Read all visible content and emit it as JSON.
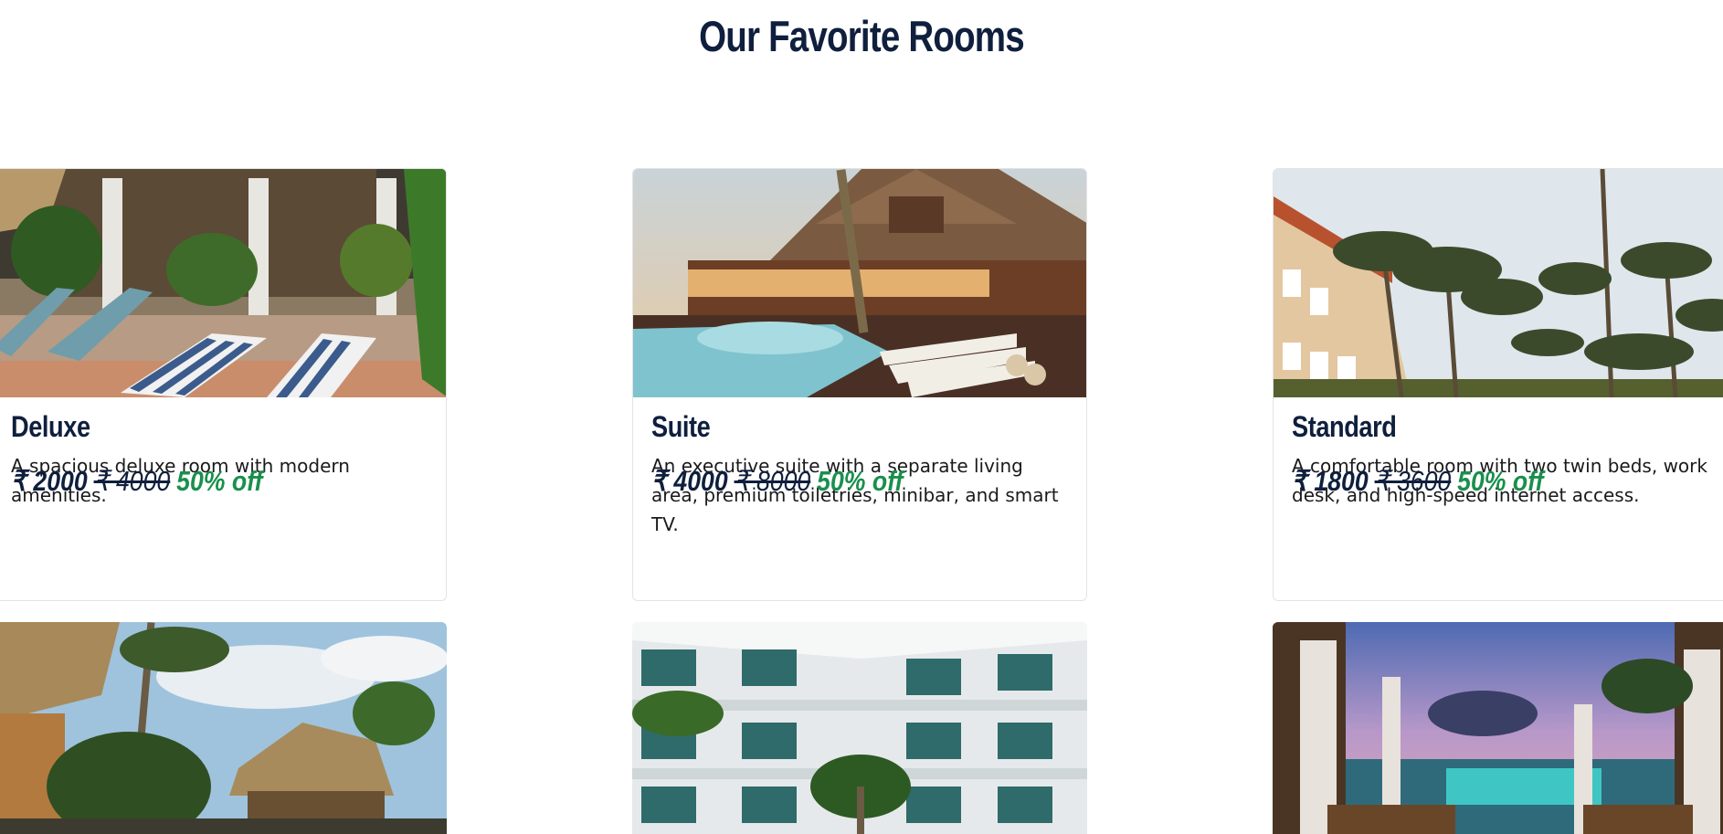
{
  "section": {
    "title": "Our Favorite Rooms"
  },
  "rooms": [
    {
      "name": "Deluxe",
      "description": "A spacious deluxe room with modern amenities.",
      "price": "₹ 2000",
      "original_price": "₹ 4000",
      "discount": "50% off"
    },
    {
      "name": "Suite",
      "description": "An executive suite with a separate living area, premium toiletries, minibar, and smart TV.",
      "price": "₹ 4000",
      "original_price": "₹ 8000",
      "discount": "50% off"
    },
    {
      "name": "Standard",
      "description": "A comfortable room with two twin beds, work desk, and high-speed internet access.",
      "price": "₹ 1800",
      "original_price": "₹ 3600",
      "discount": "50% off"
    }
  ],
  "colors": {
    "heading": "#0f1f3d",
    "discount": "#1a8f4d",
    "card_border": "#e3e3e3"
  }
}
